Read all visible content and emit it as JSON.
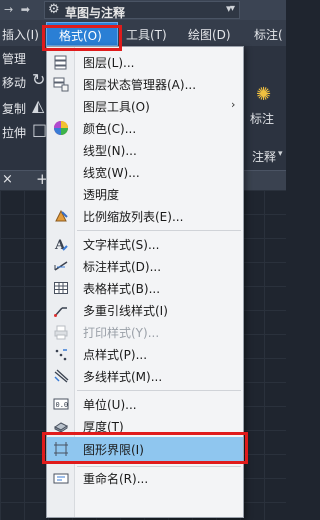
{
  "titlebar": {
    "arrows": "→ ➡",
    "workspace_label": "草图与注释",
    "workspace_caret": "▾",
    "extra": "▾"
  },
  "menubar": {
    "items": [
      {
        "label": "插入(I)"
      },
      {
        "label": "格式(O)"
      },
      {
        "label": "工具(T)"
      },
      {
        "label": "绘图(D)"
      },
      {
        "label": "标注("
      }
    ]
  },
  "ribbon": {
    "left_labels": [
      "管理",
      "移动",
      "复制",
      "拉伸"
    ],
    "dim_label": "标注",
    "annot_label": "注释",
    "annot_caret": "▾",
    "panel_caret": "▾"
  },
  "doctabs": {
    "close": "×",
    "add": "+"
  },
  "dropdown": {
    "items": [
      {
        "label": "图层(L)...",
        "icon": "layers-icon"
      },
      {
        "label": "图层状态管理器(A)...",
        "icon": "layer-state-icon"
      },
      {
        "label": "图层工具(O)",
        "icon": "none",
        "submenu": "›"
      },
      {
        "label": "颜色(C)...",
        "icon": "color-wheel-icon"
      },
      {
        "label": "线型(N)...",
        "icon": "none"
      },
      {
        "label": "线宽(W)...",
        "icon": "none"
      },
      {
        "label": "透明度",
        "icon": "none"
      },
      {
        "label": "比例缩放列表(E)...",
        "icon": "scale-list-icon"
      },
      {
        "label": "文字样式(S)...",
        "icon": "text-style-icon"
      },
      {
        "label": "标注样式(D)...",
        "icon": "dim-style-icon"
      },
      {
        "label": "表格样式(B)...",
        "icon": "table-style-icon"
      },
      {
        "label": "多重引线样式(I)",
        "icon": "mleader-style-icon"
      },
      {
        "label": "打印样式(Y)...",
        "icon": "print-style-icon",
        "disabled": true
      },
      {
        "label": "点样式(P)...",
        "icon": "point-style-icon"
      },
      {
        "label": "多线样式(M)...",
        "icon": "mline-style-icon"
      },
      {
        "label": "单位(U)...",
        "icon": "units-icon"
      },
      {
        "label": "厚度(T)",
        "icon": "thickness-icon"
      },
      {
        "label": "图形界限(I)",
        "icon": "limits-icon",
        "selected": true
      },
      {
        "label": "重命名(R)...",
        "icon": "rename-icon"
      }
    ]
  },
  "colors": {
    "accent": "#2a7fd5",
    "highlight_box": "#e01b1b",
    "selected_row": "#8fc6ef",
    "menu_bg": "#f3f4f6"
  }
}
